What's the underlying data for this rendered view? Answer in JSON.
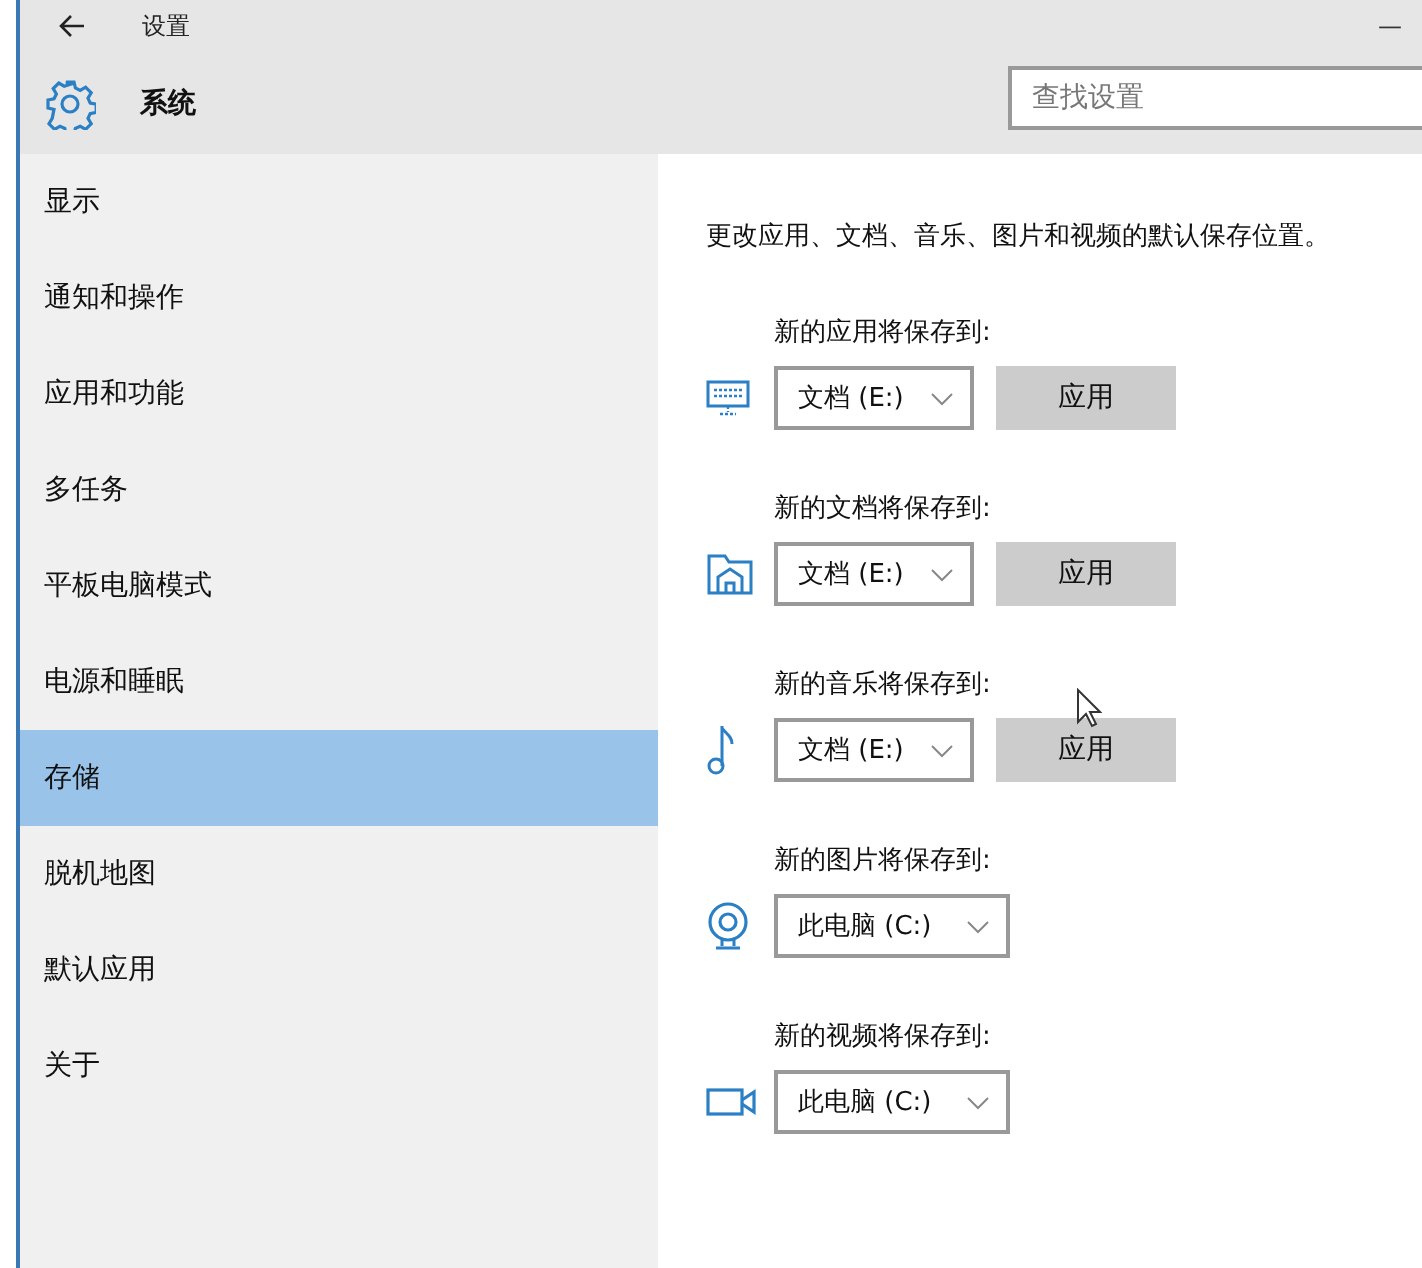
{
  "window": {
    "title": "设置",
    "minimize": "—"
  },
  "header": {
    "section": "系统",
    "search": {
      "placeholder": "查找设置"
    }
  },
  "sidebar": {
    "items": [
      {
        "label": "显示",
        "selected": false
      },
      {
        "label": "通知和操作",
        "selected": false
      },
      {
        "label": "应用和功能",
        "selected": false
      },
      {
        "label": "多任务",
        "selected": false
      },
      {
        "label": "平板电脑模式",
        "selected": false
      },
      {
        "label": "电源和睡眠",
        "selected": false
      },
      {
        "label": "存储",
        "selected": true
      },
      {
        "label": "脱机地图",
        "selected": false
      },
      {
        "label": "默认应用",
        "selected": false
      },
      {
        "label": "关于",
        "selected": false
      }
    ]
  },
  "content": {
    "description": "更改应用、文档、音乐、图片和视频的默认保存位置。",
    "locations": [
      {
        "label": "新的应用将保存到:",
        "value": "文档 (E:)",
        "button": "应用"
      },
      {
        "label": "新的文档将保存到:",
        "value": "文档 (E:)",
        "button": "应用"
      },
      {
        "label": "新的音乐将保存到:",
        "value": "文档 (E:)",
        "button": "应用"
      },
      {
        "label": "新的图片将保存到:",
        "value": "此电脑 (C:)"
      },
      {
        "label": "新的视频将保存到:",
        "value": "此电脑 (C:)"
      }
    ]
  }
}
